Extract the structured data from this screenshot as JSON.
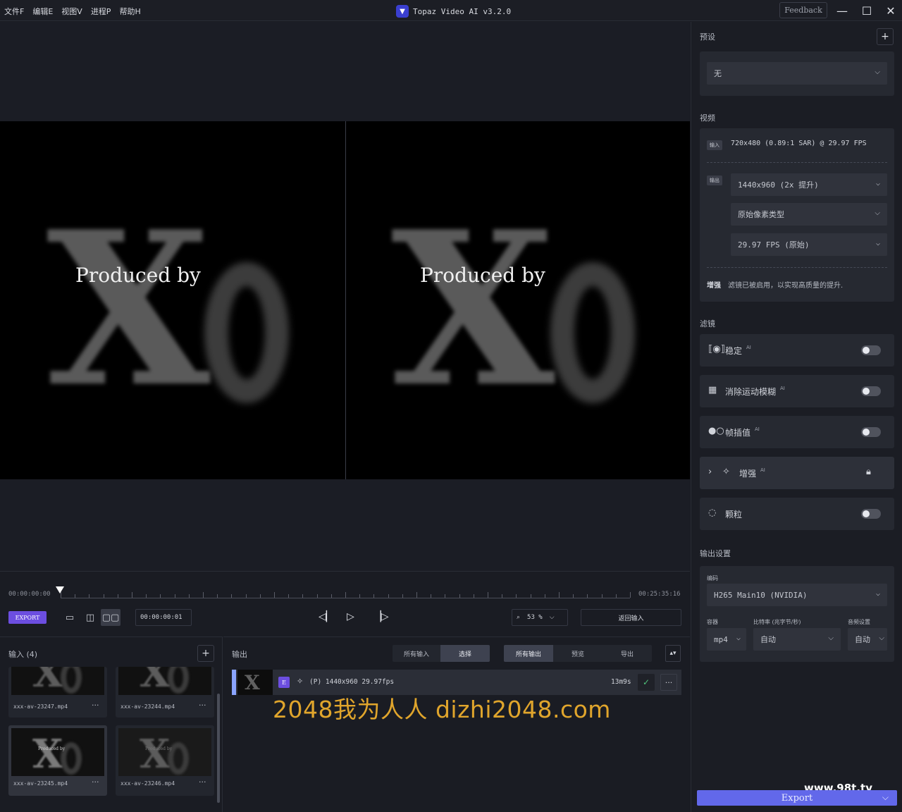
{
  "menu": [
    "文件F",
    "编辑E",
    "视图V",
    "进程P",
    "帮助H"
  ],
  "app": {
    "title": "Topaz Video AI   v3.2.0",
    "feedback": "Feedback"
  },
  "window": {
    "minimize_icon": "minimize-icon",
    "maximize_icon": "maximize-icon",
    "close_icon": "close-icon"
  },
  "preview": {
    "overlay_text": "Produced by",
    "frame_glyph": "X"
  },
  "timeline": {
    "start": "00:00:00:00",
    "end": "00:25:35:16",
    "export_label": "EXPORT",
    "timecode": "00:00:00:01",
    "zoom": "53 %",
    "return_label": "返回输入"
  },
  "input": {
    "title": "输入 (4)",
    "items": [
      {
        "name": "xxx-av-23247.mp4"
      },
      {
        "name": "xxx-av-23244.mp4"
      },
      {
        "name": "xxx-av-23245.mp4",
        "thumb_text": "Produced by"
      },
      {
        "name": "xxx-av-23246.mp4",
        "thumb_text": "Produced by"
      }
    ],
    "more": "···"
  },
  "output": {
    "title": "输出",
    "filter_a": [
      "所有输入",
      "选择"
    ],
    "filter_b": [
      "所有输出",
      "预览",
      "导出"
    ],
    "row": {
      "badge": "E",
      "desc": "(P)  1440x960  29.97fps",
      "time": "13m9s",
      "more": "···"
    },
    "watermark": "2048我为人人  dizhi2048.com"
  },
  "sidebar": {
    "preset_title": "预设",
    "preset_value": "无",
    "video_title": "视频",
    "input_tag": "输入",
    "input_info": "720x480 (0.89:1 SAR) @ 29.97 FPS",
    "output_tag": "输出",
    "resolution": "1440x960 (2x 提升)",
    "pixel_type": "原始像素类型",
    "fps": "29.97 FPS (原始)",
    "enhance_note_label": "增强",
    "enhance_note": "滤镜已被启用，以实现高质量的提升.",
    "filters_title": "滤镜",
    "filters": [
      {
        "name": "稳定",
        "ai": "AI"
      },
      {
        "name": "消除运动模糊",
        "ai": "AI"
      },
      {
        "name": "帧插值",
        "ai": "AI"
      },
      {
        "name": "增强",
        "ai": "AI"
      },
      {
        "name": "颗粒",
        "ai": ""
      }
    ],
    "output_settings_title": "输出设置",
    "codec_label": "编码",
    "codec": "H265 Main10 (NVIDIA)",
    "container_label": "容器",
    "container": "mp4",
    "bitrate_label": "比特率 (兆字节/秒)",
    "bitrate": "自动",
    "audio_label": "音频设置",
    "audio": "自动",
    "export_label": "Export",
    "site_mark": "www.98t.tv"
  }
}
